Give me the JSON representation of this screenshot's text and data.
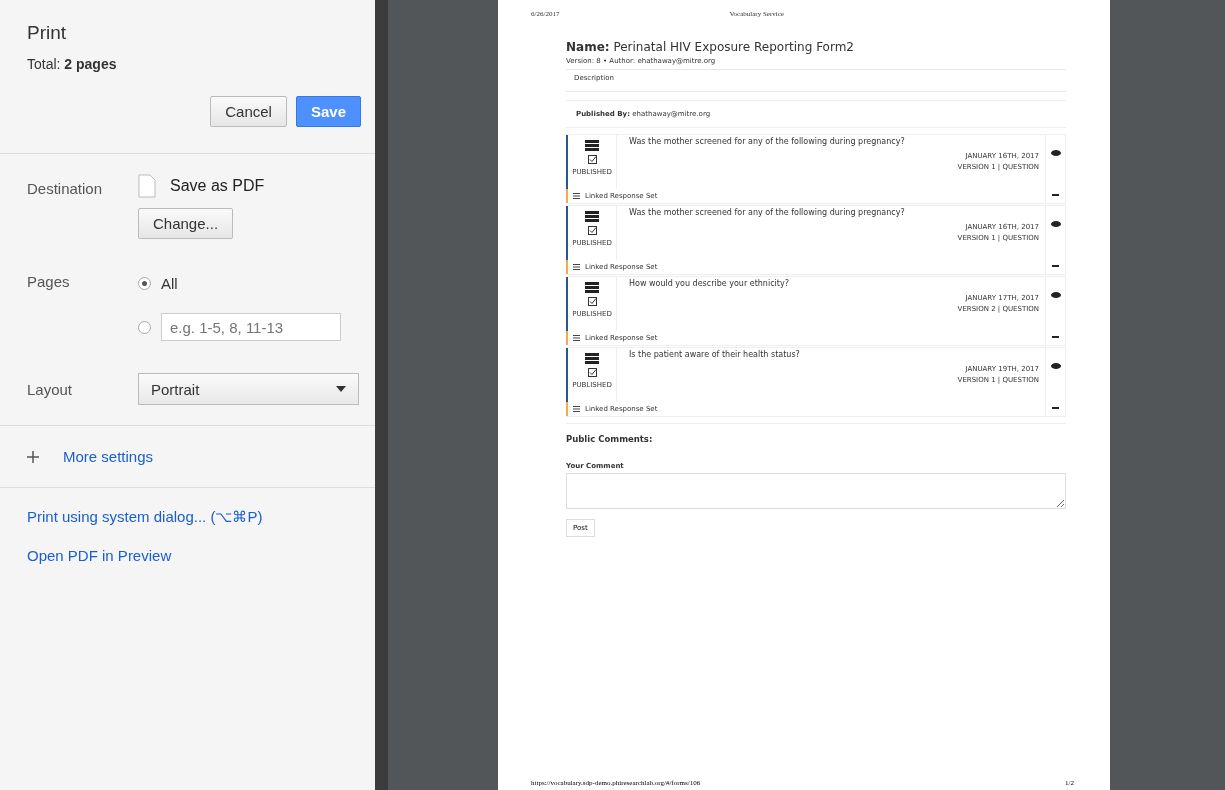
{
  "sidebar": {
    "title": "Print",
    "total": "Total: **2 pages**",
    "buttons": [
      {
        "label": "Cancel",
        "kind": "secondary"
      },
      {
        "label": "Save",
        "kind": "primary"
      }
    ],
    "destination": {
      "label": "Destination",
      "value": "Save as PDF",
      "change": "Change..."
    },
    "pages": {
      "label": "Pages",
      "options": [
        {
          "kind": "all",
          "label": "All",
          "selected": true
        },
        {
          "kind": "custom",
          "placeholder": "e.g. 1-5, 8, 11-13",
          "selected": false
        }
      ]
    },
    "layout": {
      "label": "Layout",
      "value": "Portrait"
    },
    "more_settings": "More settings",
    "links": [
      "Print using system dialog... (⌥⌘P)",
      "Open PDF in Preview"
    ]
  },
  "preview": {
    "header_date": "6/26/2017",
    "header_title": "Vocabulary Service",
    "name": "**Name:** Perinatal HIV Exposure Reporting Form2",
    "meta": "Version: 8 • Author: ehathaway@mitre.org",
    "description": "Description",
    "published_by": "**Published By:** ehathaway@mitre.org",
    "questions": [
      {
        "text": "Was the mother screened for any of the following during pregnancy?",
        "status": "PUBLISHED",
        "date": "JANUARY 16TH, 2017",
        "version": "VERSION 1 | QUESTION",
        "linked": "Linked Response Set"
      },
      {
        "text": "Was the mother screened for any of the following during pregnancy?",
        "status": "PUBLISHED",
        "date": "JANUARY 16TH, 2017",
        "version": "VERSION 1 | QUESTION",
        "linked": "Linked Response Set"
      },
      {
        "text": "How would you describe your ethnicity?",
        "status": "PUBLISHED",
        "date": "JANUARY 17TH, 2017",
        "version": "VERSION 2 | QUESTION",
        "linked": "Linked Response Set"
      },
      {
        "text": "Is the patient aware of their health status?",
        "status": "PUBLISHED",
        "date": "JANUARY 19TH, 2017",
        "version": "VERSION 1 | QUESTION",
        "linked": "Linked Response Set"
      }
    ],
    "comments_title": "Public Comments:",
    "comment_label": "Your Comment",
    "post": "Post",
    "footer_url": "https://vocabulary.sdp-demo.phiresearchlab.org/#/forms/106",
    "footer_page": "1/2"
  }
}
